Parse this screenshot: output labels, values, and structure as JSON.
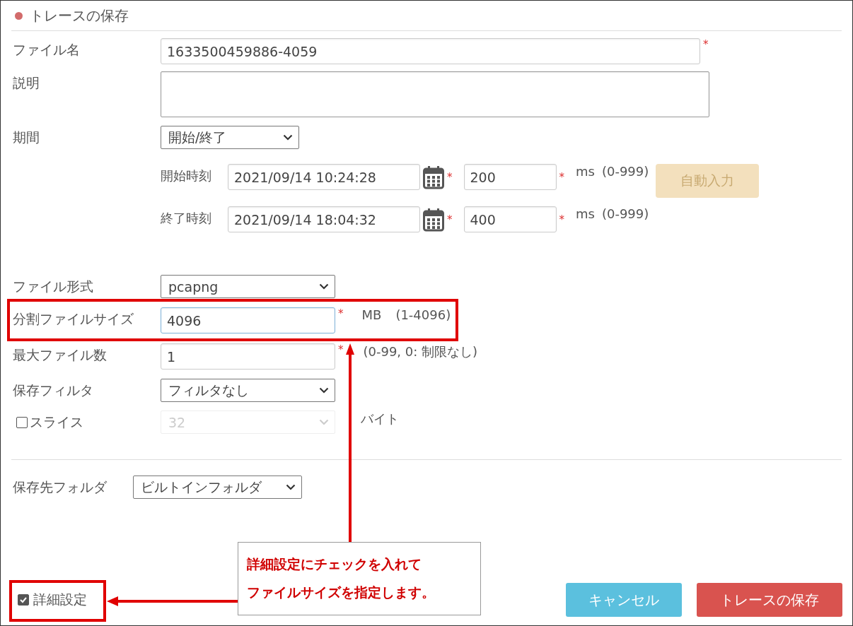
{
  "dialog": {
    "title": "トレースの保存"
  },
  "file_name": {
    "label": "ファイル名",
    "value": "1633500459886-4059",
    "mark": "*"
  },
  "description": {
    "label": "説明"
  },
  "period": {
    "label": "期間",
    "value": "開始/終了"
  },
  "times": [
    {
      "label": "開始時刻",
      "date": "2021/09/14 10:24:28",
      "date_mark": "*",
      "ms": "200",
      "ms_mark": "*",
      "unit": "ms",
      "range": "(0-999)"
    },
    {
      "label": "終了時刻",
      "date": "2021/09/14 18:04:32",
      "date_mark": "*",
      "ms": "400",
      "ms_mark": "*",
      "unit": "ms",
      "range": "(0-999)"
    }
  ],
  "auto_button": {
    "label": "自動入力",
    "disabled": true
  },
  "file_format": {
    "label": "ファイル形式",
    "value": "pcapng"
  },
  "split_size": {
    "label": "分割ファイルサイズ",
    "value": "4096",
    "mark": "*",
    "unit": "MB",
    "range": "(1-4096)",
    "focused": true
  },
  "max_files": {
    "label": "最大ファイル数",
    "value": "1",
    "mark": "*",
    "hint": "(0-99, 0: 制限なし)"
  },
  "save_filter": {
    "label": "保存フィルタ",
    "value": "フィルタなし"
  },
  "slice": {
    "label": "スライス",
    "checked": false,
    "value": "32",
    "disabled": true,
    "unit": "バイト"
  },
  "save_folder": {
    "label": "保存先フォルダ",
    "value": "ビルトインフォルダ"
  },
  "advanced": {
    "label": "詳細設定",
    "checked": true
  },
  "buttons": [
    {
      "label": "キャンセル",
      "kind": "secondary"
    },
    {
      "label": "トレースの保存",
      "kind": "primary"
    }
  ],
  "callout": {
    "lines": [
      "詳細設定にチェックを入れて",
      "ファイルサイズを指定します。"
    ]
  }
}
